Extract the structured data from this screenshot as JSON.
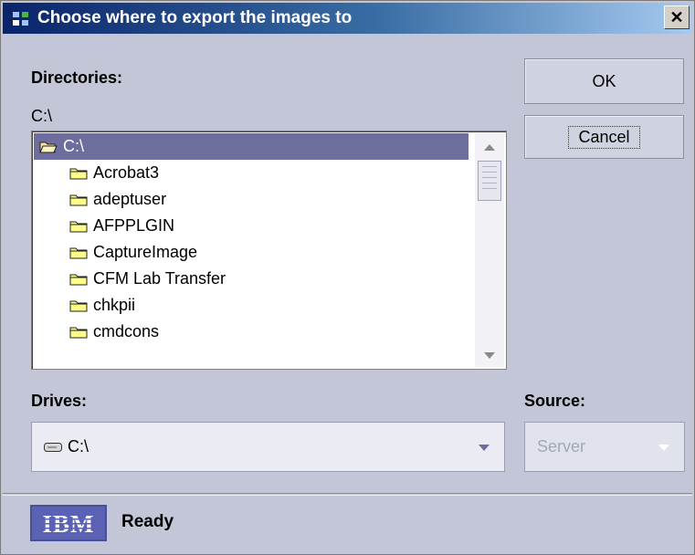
{
  "window": {
    "title": "Choose where to export the images to",
    "close_label": "✕"
  },
  "directories": {
    "label": "Directories:",
    "current_path": "C:\\",
    "tree": [
      {
        "label": "C:\\",
        "icon": "open-folder-icon",
        "selected": true
      },
      {
        "label": "Acrobat3",
        "icon": "folder-icon"
      },
      {
        "label": "adeptuser",
        "icon": "folder-icon"
      },
      {
        "label": "AFPPLGIN",
        "icon": "folder-icon"
      },
      {
        "label": "CaptureImage",
        "icon": "folder-icon"
      },
      {
        "label": "CFM Lab Transfer",
        "icon": "folder-icon"
      },
      {
        "label": "chkpii",
        "icon": "folder-icon"
      },
      {
        "label": "cmdcons",
        "icon": "folder-icon"
      }
    ]
  },
  "buttons": {
    "ok": "OK",
    "cancel": "Cancel"
  },
  "drives": {
    "label": "Drives:",
    "value": "C:\\",
    "icon": "drive-icon"
  },
  "source": {
    "label": "Source:",
    "value": "Server",
    "disabled": true
  },
  "status": {
    "text": "Ready",
    "logo": "IBM"
  },
  "colors": {
    "selection": "#6d6d9e",
    "dialog_bg": "#c3c6d6",
    "title_start": "#0a246a",
    "title_end": "#a6caf0"
  }
}
